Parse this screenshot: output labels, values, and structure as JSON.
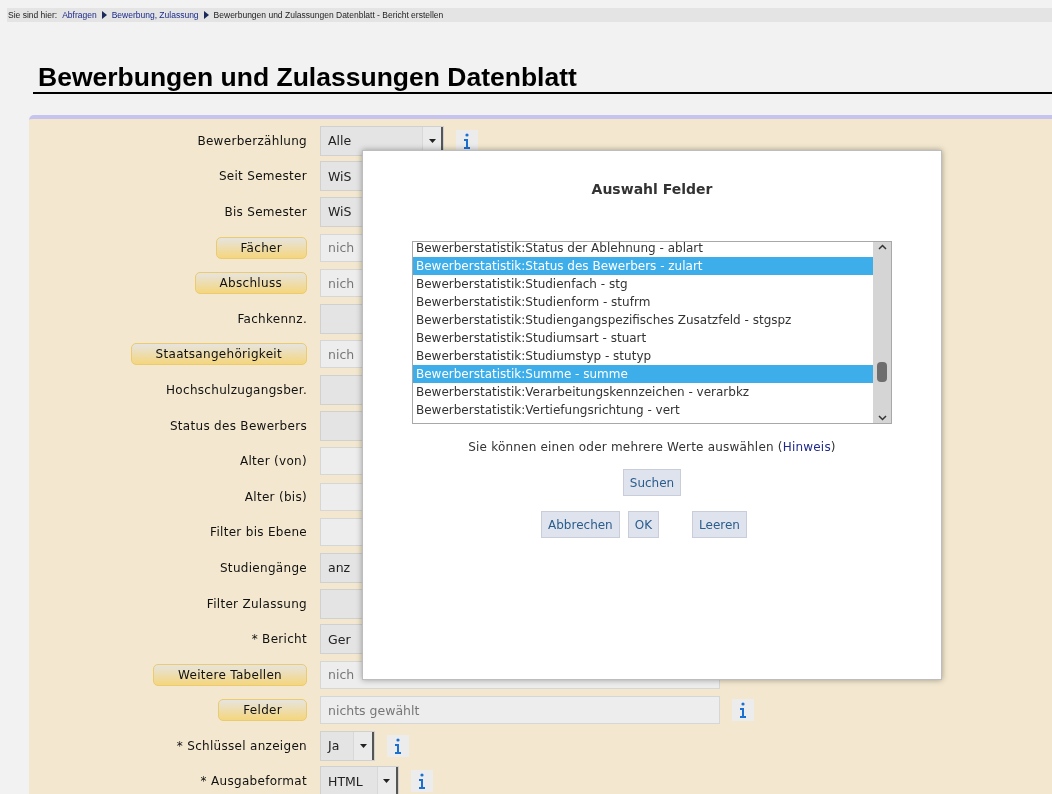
{
  "breadcrumb": {
    "label": "Sie sind hier:",
    "links": [
      "Abfragen",
      "Bewerbung, Zulassung"
    ],
    "current": "Bewerbungen und Zulassungen Datenblatt - Bericht erstellen"
  },
  "title": "Bewerbungen und Zulassungen Datenblatt",
  "form": {
    "rows": [
      {
        "label": {
          "kind": "text",
          "text": "Bewerberzählung"
        },
        "control": {
          "kind": "select",
          "value": "Alle",
          "dropdown": true
        },
        "info": true
      },
      {
        "label": {
          "kind": "text",
          "text": "Seit Semester"
        },
        "control": {
          "kind": "select",
          "value": "WiS"
        }
      },
      {
        "label": {
          "kind": "text",
          "text": "Bis Semester"
        },
        "control": {
          "kind": "select",
          "value": "WiS"
        }
      },
      {
        "label": {
          "kind": "button",
          "text": "Fächer"
        },
        "control": {
          "kind": "input",
          "placeholder": "nich"
        }
      },
      {
        "label": {
          "kind": "button",
          "text": "Abschluss"
        },
        "control": {
          "kind": "input",
          "placeholder": "nich"
        }
      },
      {
        "label": {
          "kind": "text",
          "text": "Fachkennz."
        },
        "control": {
          "kind": "select"
        }
      },
      {
        "label": {
          "kind": "button",
          "text": "Staatsangehörigkeit"
        },
        "control": {
          "kind": "input",
          "placeholder": "nich"
        }
      },
      {
        "label": {
          "kind": "text",
          "text": "Hochschulzugangsber."
        },
        "control": {
          "kind": "select"
        }
      },
      {
        "label": {
          "kind": "text",
          "text": "Status des Bewerbers"
        },
        "control": {
          "kind": "select"
        }
      },
      {
        "label": {
          "kind": "text",
          "text": "Alter (von)"
        },
        "control": {
          "kind": "number"
        }
      },
      {
        "label": {
          "kind": "text",
          "text": "Alter (bis)"
        },
        "control": {
          "kind": "number"
        }
      },
      {
        "label": {
          "kind": "text",
          "text": "Filter bis Ebene"
        },
        "control": {
          "kind": "number"
        }
      },
      {
        "label": {
          "kind": "text",
          "text": "Studiengänge"
        },
        "control": {
          "kind": "select",
          "value": "anz"
        }
      },
      {
        "label": {
          "kind": "text",
          "text": "Filter Zulassung"
        },
        "control": {
          "kind": "select"
        }
      },
      {
        "label": {
          "kind": "text",
          "text": "* Bericht"
        },
        "control": {
          "kind": "select",
          "value": "Ger"
        }
      },
      {
        "label": {
          "kind": "button",
          "text": "Weitere Tabellen"
        },
        "control": {
          "kind": "input",
          "placeholder": "nich"
        }
      },
      {
        "label": {
          "kind": "button",
          "text": "Felder"
        },
        "control": {
          "kind": "input",
          "placeholder": "nichts gewählt"
        },
        "info": true
      },
      {
        "label": {
          "kind": "text",
          "text": "* Schlüssel anzeigen"
        },
        "control": {
          "kind": "combo",
          "value": "Ja",
          "dropdown": true
        },
        "info": true
      },
      {
        "label": {
          "kind": "text",
          "text": "* Ausgabeformat"
        },
        "control": {
          "kind": "combo",
          "value": "HTML",
          "dropdown": true
        },
        "info": true
      }
    ]
  },
  "dialog": {
    "title": "Auswahl Felder",
    "options": [
      {
        "label": "Bewerberstatistik:Status der Ablehnung - ablart",
        "selected": false
      },
      {
        "label": "Bewerberstatistik:Status des Bewerbers - zulart",
        "selected": true
      },
      {
        "label": "Bewerberstatistik:Studienfach - stg",
        "selected": false
      },
      {
        "label": "Bewerberstatistik:Studienform - stufrm",
        "selected": false
      },
      {
        "label": "Bewerberstatistik:Studiengangspezifisches Zusatzfeld - stgspz",
        "selected": false
      },
      {
        "label": "Bewerberstatistik:Studiumsart - stuart",
        "selected": false
      },
      {
        "label": "Bewerberstatistik:Studiumstyp - stutyp",
        "selected": false
      },
      {
        "label": "Bewerberstatistik:Summe - summe",
        "selected": true
      },
      {
        "label": "Bewerberstatistik:Verarbeitungskennzeichen - verarbkz",
        "selected": false
      },
      {
        "label": "Bewerberstatistik:Vertiefungsrichtung - vert",
        "selected": false
      }
    ],
    "hint": {
      "before": "Sie können einen oder mehrere Werte auswählen (",
      "link": "Hinweis",
      "after": ")"
    },
    "search_button": "Suchen",
    "buttons": [
      "Abbrechen",
      "OK",
      "Leeren"
    ]
  }
}
